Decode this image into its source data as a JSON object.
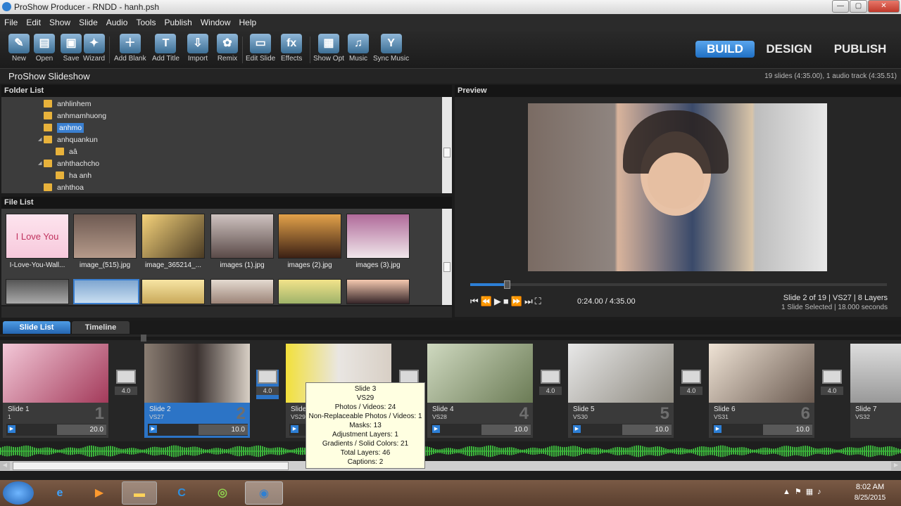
{
  "window": {
    "title": "ProShow Producer - RNDD - hanh.psh",
    "min": "—",
    "max": "▢",
    "close": "✕"
  },
  "menu": [
    "File",
    "Edit",
    "Show",
    "Slide",
    "Audio",
    "Tools",
    "Publish",
    "Window",
    "Help"
  ],
  "toolbar": [
    {
      "label": "New",
      "icon": "new-show-icon"
    },
    {
      "label": "Open",
      "icon": "open-folder-icon"
    },
    {
      "label": "Save",
      "icon": "save-disk-icon"
    },
    {
      "label": "Wizard",
      "icon": "wizard-wand-icon"
    },
    {
      "label": "Add Blank",
      "icon": "add-blank-icon"
    },
    {
      "label": "Add Title",
      "icon": "add-title-icon"
    },
    {
      "label": "Import",
      "icon": "import-icon"
    },
    {
      "label": "Remix",
      "icon": "remix-icon"
    },
    {
      "label": "Edit Slide",
      "icon": "edit-slide-icon"
    },
    {
      "label": "Effects",
      "icon": "effects-fx-icon"
    },
    {
      "label": "Show Opt",
      "icon": "show-options-icon"
    },
    {
      "label": "Music",
      "icon": "music-speaker-icon"
    },
    {
      "label": "Sync Music",
      "icon": "sync-music-icon"
    }
  ],
  "modes": {
    "build": "BUILD",
    "design": "DESIGN",
    "publish": "PUBLISH"
  },
  "show": {
    "name": "ProShow Slideshow",
    "summary": "19 slides (4:35.00), 1 audio track (4:35.51)"
  },
  "folder_list": {
    "title": "Folder List",
    "items": [
      {
        "name": "anhlinhem",
        "indent": 0,
        "selected": false
      },
      {
        "name": "anhmamhuong",
        "indent": 0,
        "selected": false
      },
      {
        "name": "anhmo",
        "indent": 0,
        "selected": true
      },
      {
        "name": "anhquankun",
        "indent": 0,
        "selected": false,
        "expanded": true
      },
      {
        "name": "aâ",
        "indent": 1,
        "selected": false
      },
      {
        "name": "anhthachcho",
        "indent": 0,
        "selected": false,
        "expanded": true
      },
      {
        "name": "ha anh",
        "indent": 1,
        "selected": false
      },
      {
        "name": "anhthoa",
        "indent": 0,
        "selected": false
      }
    ]
  },
  "file_list": {
    "title": "File List",
    "files": [
      "I-Love-You-Wall...",
      "image_(515).jpg",
      "image_365214_...",
      "images (1).jpg",
      "images (2).jpg",
      "images (3).jpg"
    ],
    "thumb_text": "I Love You"
  },
  "preview": {
    "title": "Preview",
    "time": "0:24.00 / 4:35.00",
    "progress": 0.087,
    "slide_info": "Slide 2 of 19  |  VS27  |  8 Layers",
    "selection_info": "1 Slide Selected  |  18.000 seconds"
  },
  "tabs": {
    "slide_list": "Slide List",
    "timeline": "Timeline"
  },
  "slides": [
    {
      "name": "Slide 1",
      "sub": "1",
      "num": "1",
      "dur": "20.0",
      "selected": false
    },
    {
      "name": "Slide 2",
      "sub": "VS27",
      "num": "2",
      "dur": "10.0",
      "selected": true
    },
    {
      "name": "Slide 3",
      "sub": "VS29",
      "num": "3",
      "dur": "10.0",
      "selected": false
    },
    {
      "name": "Slide 4",
      "sub": "VS28",
      "num": "4",
      "dur": "10.0",
      "selected": false
    },
    {
      "name": "Slide 5",
      "sub": "VS30",
      "num": "5",
      "dur": "10.0",
      "selected": false
    },
    {
      "name": "Slide 6",
      "sub": "VS31",
      "num": "6",
      "dur": "10.0",
      "selected": false
    },
    {
      "name": "Slide 7",
      "sub": "VS32",
      "num": "7",
      "dur": "",
      "selected": false
    }
  ],
  "transitions": [
    "4.0",
    "4.0",
    "4.0",
    "4.0",
    "4.0",
    "4.0"
  ],
  "tooltip": {
    "lines": [
      "Slide 3",
      "VS29",
      "Photos / Videos: 24",
      "Non-Replaceable Photos / Videos: 1",
      "Masks: 13",
      "Adjustment Layers: 1",
      "Gradients / Solid Colors: 21",
      "Total Layers: 46",
      "Captions: 2"
    ]
  },
  "taskbar": {
    "time": "8:02 AM",
    "date": "8/25/2015",
    "apps": [
      "windows-start-icon",
      "internet-explorer-icon",
      "media-player-icon",
      "file-explorer-icon",
      "ccleaner-icon",
      "chrome-icon",
      "proshow-icon"
    ]
  },
  "colors": {
    "accent": "#2d7fd6",
    "panel": "#3c3c3c",
    "wave": "#3cb53c"
  }
}
